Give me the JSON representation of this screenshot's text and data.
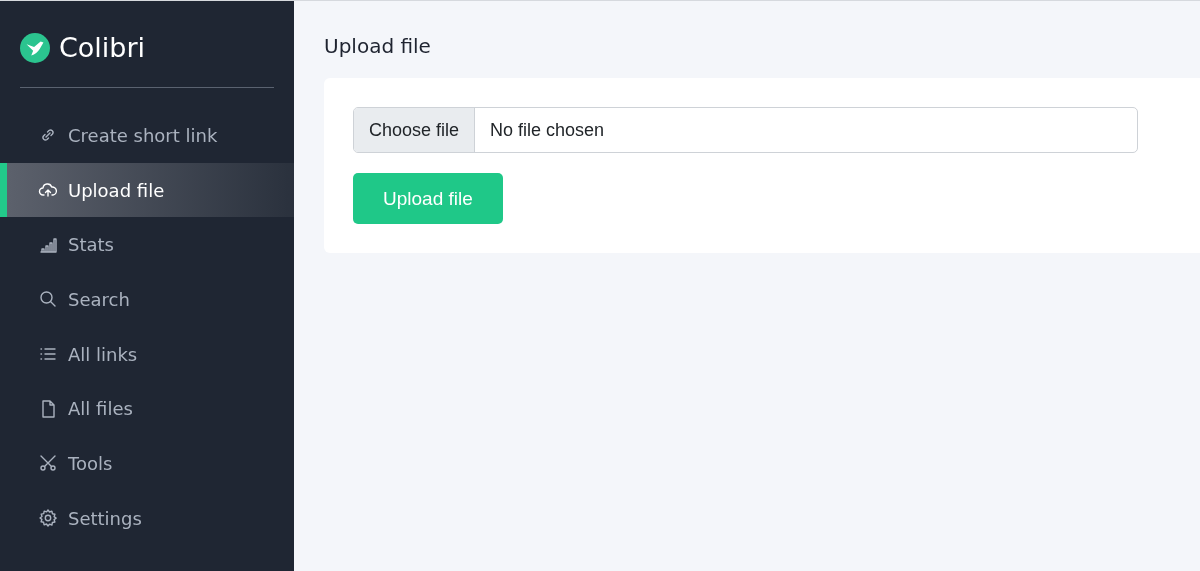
{
  "brand": {
    "name": "Colibri"
  },
  "sidebar": {
    "items": [
      {
        "label": "Create short link",
        "kind": "link",
        "selected": false
      },
      {
        "label": "Upload file",
        "kind": "upload",
        "selected": true
      },
      {
        "label": "Stats",
        "kind": "stats",
        "selected": false
      },
      {
        "label": "Search",
        "kind": "search",
        "selected": false
      },
      {
        "label": "All links",
        "kind": "list",
        "selected": false
      },
      {
        "label": "All files",
        "kind": "file",
        "selected": false
      },
      {
        "label": "Tools",
        "kind": "tools",
        "selected": false
      },
      {
        "label": "Settings",
        "kind": "settings",
        "selected": false
      }
    ]
  },
  "page": {
    "title": "Upload file"
  },
  "form": {
    "file_button": "Choose file",
    "file_status": "No file chosen",
    "submit": "Upload file"
  }
}
